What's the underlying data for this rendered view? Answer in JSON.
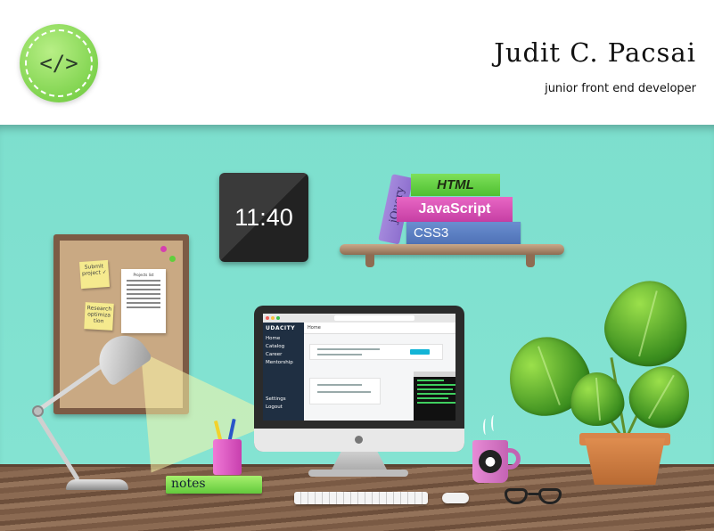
{
  "header": {
    "logo_text": "</>",
    "name": "Judit C. Pacsai",
    "role": "junior front end developer"
  },
  "clock": {
    "time": "11:40"
  },
  "shelf": {
    "books": {
      "css": "CSS3",
      "javascript": "JavaScript",
      "html": "HTML",
      "jquery": "jQuery"
    }
  },
  "board": {
    "sticky_1": "Submit project ✓",
    "sticky_2": "Research optimiza tion",
    "paper_title": "Projects list"
  },
  "monitor": {
    "brand": "UDACITY",
    "sidebar_items": [
      "Home",
      "Catalog",
      "Career",
      "Mentorship"
    ],
    "sidebar_lower": [
      "Settings",
      "Logout"
    ],
    "content_title": "Home"
  },
  "desk": {
    "notes_label": "notes"
  },
  "colors": {
    "wall": "#84e3d2",
    "logo": "#7fd34e",
    "book_css": "#4f72b6",
    "book_js": "#c63fa4",
    "book_html": "#4fbf31",
    "book_jquery": "#8e70cf"
  },
  "icons": [
    "code-icon",
    "github-icon"
  ]
}
